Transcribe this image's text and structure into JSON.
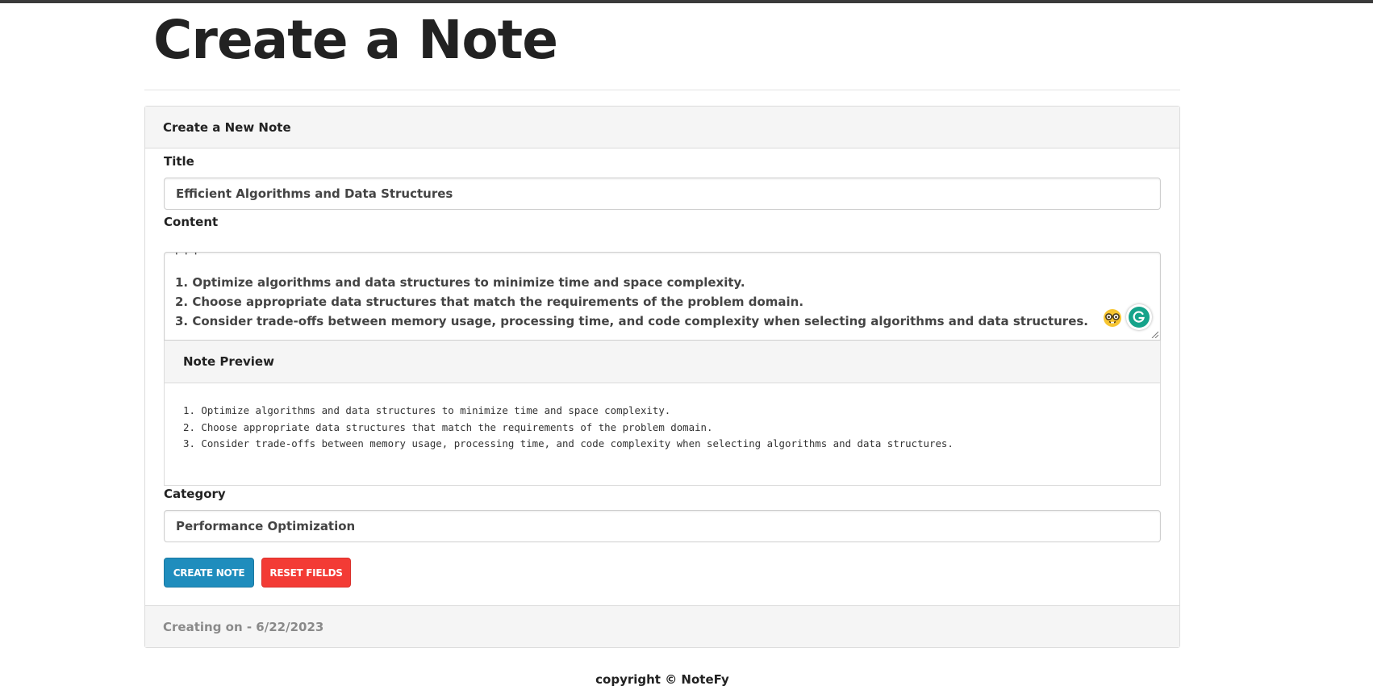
{
  "page": {
    "title": "Create a Note"
  },
  "card": {
    "header": "Create a New Note",
    "footer": "Creating on - 6/22/2023"
  },
  "form": {
    "title_label": "Title",
    "title_value": "Efficient Algorithms and Data Structures",
    "content_label": "Content",
    "content_lines": [
      "' ' '",
      "1. Optimize algorithms and data structures to minimize time and space complexity.",
      "2. Choose appropriate data structures that match the requirements of the problem domain.",
      "3. Consider trade-offs between memory usage, processing time, and code complexity when selecting algorithms and data structures."
    ],
    "category_label": "Category",
    "category_value": "Performance Optimization"
  },
  "preview": {
    "header": "Note Preview",
    "lines": [
      "1. Optimize algorithms and data structures to minimize time and space complexity.",
      "2. Choose appropriate data structures that match the requirements of the problem domain.",
      "3. Consider trade-offs between memory usage, processing time, and code complexity when selecting algorithms and data structures."
    ]
  },
  "buttons": {
    "create": "CREATE NOTE",
    "reset": "RESET FIELDS"
  },
  "footer": {
    "copyright": "copyright © NoteFy"
  },
  "icons": {
    "emoji": "nerd-face-icon",
    "grammarly": "grammarly-icon"
  },
  "colors": {
    "create_button": "#1f8dbd",
    "reset_button": "#f33b35",
    "grammarly": "#15a38a"
  }
}
